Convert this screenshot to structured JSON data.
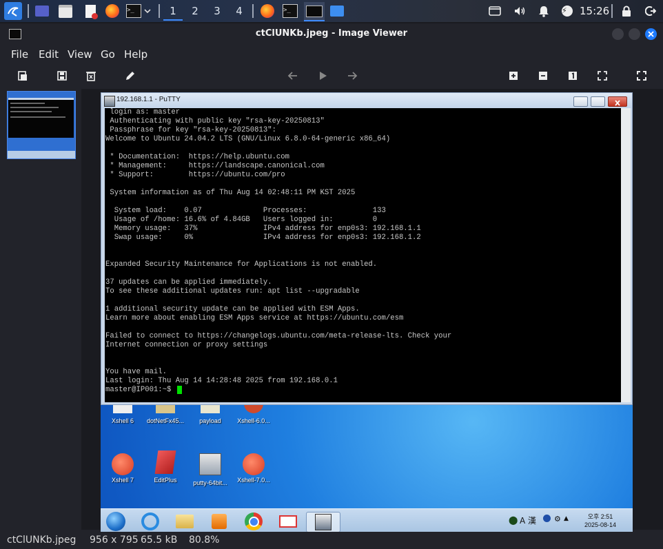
{
  "taskbar": {
    "workspaces": [
      "1",
      "2",
      "3",
      "4"
    ],
    "clock": "15:26"
  },
  "viewer": {
    "title": "ctClUNKb.jpeg - Image Viewer",
    "menu": [
      "File",
      "Edit",
      "View",
      "Go",
      "Help"
    ],
    "status": {
      "filename": "ctClUNKb.jpeg",
      "dimensions": "956 x 795",
      "filesize": "65.5 kB",
      "zoom": "80.8%"
    }
  },
  "putty": {
    "title": "192.168.1.1 - PuTTY",
    "lines": [
      " login as: master",
      " Authenticating with public key \"rsa-key-20250813\"",
      " Passphrase for key \"rsa-key-20250813\":",
      "Welcome to Ubuntu 24.04.2 LTS (GNU/Linux 6.8.0-64-generic x86_64)",
      "",
      " * Documentation:  https://help.ubuntu.com",
      " * Management:     https://landscape.canonical.com",
      " * Support:        https://ubuntu.com/pro",
      "",
      " System information as of Thu Aug 14 02:48:11 PM KST 2025",
      "",
      "  System load:    0.07              Processes:               133",
      "  Usage of /home: 16.6% of 4.84GB   Users logged in:         0",
      "  Memory usage:   37%               IPv4 address for enp0s3: 192.168.1.1",
      "  Swap usage:     0%                IPv4 address for enp0s3: 192.168.1.2",
      "",
      "",
      "Expanded Security Maintenance for Applications is not enabled.",
      "",
      "37 updates can be applied immediately.",
      "To see these additional updates run: apt list --upgradable",
      "",
      "1 additional security update can be applied with ESM Apps.",
      "Learn more about enabling ESM Apps service at https://ubuntu.com/esm",
      "",
      "Failed to connect to https://changelogs.ubuntu.com/meta-release-lts. Check your",
      "Internet connection or proxy settings",
      "",
      "",
      "You have mail.",
      "Last login: Thu Aug 14 14:28:48 2025 from 192.168.0.1",
      "master@IP001:~$ "
    ]
  },
  "desktop": {
    "icons_row1": [
      "Xshell 6",
      "dotNetFx45...",
      "payload",
      "Xshell-6.0..."
    ],
    "icons_row2": [
      "Xshell 7",
      "EditPlus",
      "putty-64bit...",
      "Xshell-7.0..."
    ],
    "tray_ime": "A 漢",
    "tray_time": "오후 2:51",
    "tray_date": "2025-08-14"
  },
  "colors": {
    "accent": "#3f8cff",
    "terminal_bg": "#000000",
    "cursor": "#00e000",
    "close": "#1e7bff"
  }
}
